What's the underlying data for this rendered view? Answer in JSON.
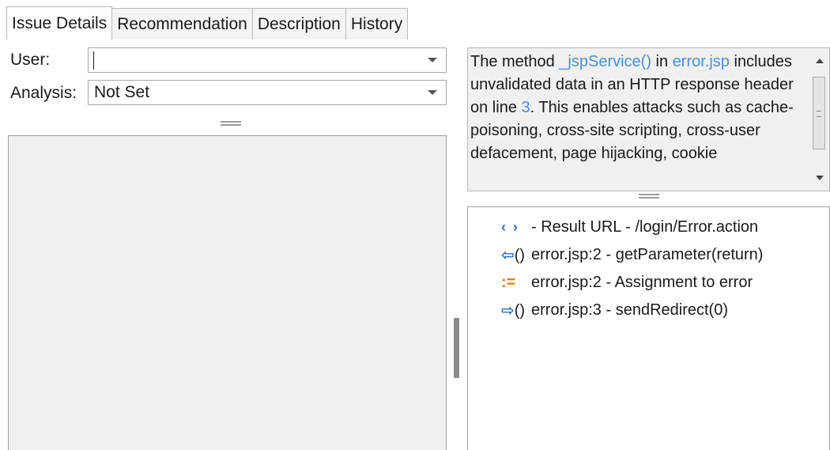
{
  "tabs": [
    {
      "label": "Issue Details",
      "active": true
    },
    {
      "label": "Recommendation",
      "active": false
    },
    {
      "label": "Description",
      "active": false
    },
    {
      "label": "History",
      "active": false
    }
  ],
  "form": {
    "user_label": "User:",
    "user_value": "",
    "analysis_label": "Analysis:",
    "analysis_value": "Not Set"
  },
  "description": {
    "pre": "The method ",
    "method_link": "_jspService()",
    "mid1": " in ",
    "file_link": "error.jsp",
    "mid2": " includes unvalidated data in an HTTP response header on line ",
    "line_link": "3",
    "post": ". This enables attacks such as cache-poisoning, cross-site scripting, cross-user defacement, page hijacking, cookie"
  },
  "trace": [
    {
      "icon": "angle-brackets-icon",
      "glyph": "‹ ›",
      "text": "- Result URL - /login/Error.action"
    },
    {
      "icon": "input-arrow-icon",
      "glyph": "⇦",
      "text": "error.jsp:2 - getParameter(return)"
    },
    {
      "icon": "assignment-icon",
      "glyph": ":=",
      "text": "error.jsp:2 - Assignment to error"
    },
    {
      "icon": "output-arrow-icon",
      "glyph": "⇨",
      "text": "error.jsp:3 - sendRedirect(0)"
    }
  ],
  "colors": {
    "link": "#4a90d9",
    "icon_blue": "#2b6fc2",
    "icon_orange": "#d9821a",
    "panel_bg": "#f0f0f0"
  }
}
